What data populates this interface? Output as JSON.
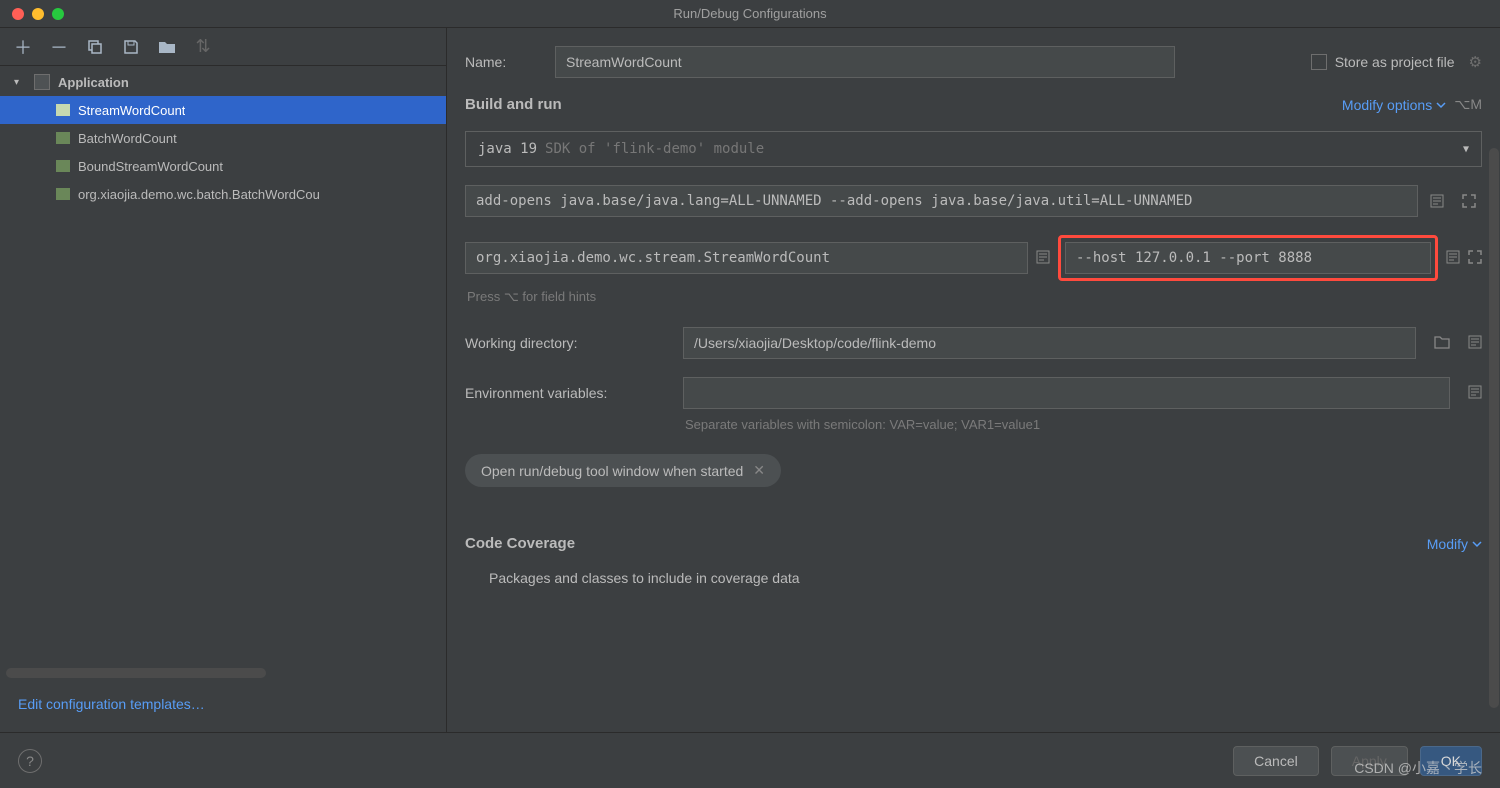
{
  "titlebar": {
    "title": "Run/Debug Configurations"
  },
  "sidebar": {
    "tree_root": "Application",
    "items": [
      {
        "label": "StreamWordCount",
        "selected": true
      },
      {
        "label": "BatchWordCount"
      },
      {
        "label": "BoundStreamWordCount"
      },
      {
        "label": "org.xiaojia.demo.wc.batch.BatchWordCou"
      }
    ],
    "edit_templates": "Edit configuration templates…"
  },
  "form": {
    "name_label": "Name:",
    "name_value": "StreamWordCount",
    "store_label": "Store as project file",
    "build_run": "Build and run",
    "modify_options": "Modify options",
    "modify_shortcut": "⌥M",
    "jre_main": "java 19",
    "jre_sub": "SDK of 'flink-demo' module",
    "vm_options": "add-opens java.base/java.lang=ALL-UNNAMED --add-opens java.base/java.util=ALL-UNNAMED",
    "main_class": "org.xiaojia.demo.wc.stream.StreamWordCount",
    "program_args": "--host 127.0.0.1 --port 8888",
    "hint": "Press ⌥ for field hints",
    "workdir_label": "Working directory:",
    "workdir_value": "/Users/xiaojia/Desktop/code/flink-demo",
    "env_label": "Environment variables:",
    "env_value": "",
    "env_helper": "Separate variables with semicolon: VAR=value; VAR1=value1",
    "chip": "Open run/debug tool window when started",
    "coverage_title": "Code Coverage",
    "coverage_modify": "Modify",
    "coverage_sub": "Packages and classes to include in coverage data"
  },
  "footer": {
    "cancel": "Cancel",
    "apply": "Apply",
    "ok": "OK"
  },
  "watermark": "CSDN @小嘉丶学长"
}
